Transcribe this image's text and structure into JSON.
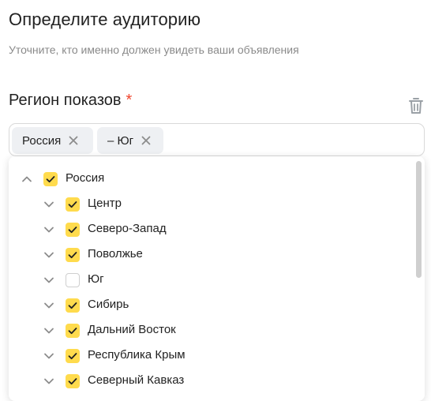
{
  "header": {
    "title": "Определите аудиторию",
    "subtitle": "Уточните, кто именно должен увидеть ваши объявления"
  },
  "region": {
    "label": "Регион показов",
    "required_mark": "*",
    "chips": [
      {
        "label": "Россия"
      },
      {
        "label": "– Юг"
      }
    ]
  },
  "tree": {
    "root": {
      "label": "Россия",
      "checked": true,
      "expanded": true
    },
    "children": [
      {
        "label": "Центр",
        "checked": true
      },
      {
        "label": "Северо-Запад",
        "checked": true
      },
      {
        "label": "Поволжье",
        "checked": true
      },
      {
        "label": "Юг",
        "checked": false
      },
      {
        "label": "Сибирь",
        "checked": true
      },
      {
        "label": "Дальний Восток",
        "checked": true
      },
      {
        "label": "Республика Крым",
        "checked": true
      },
      {
        "label": "Северный Кавказ",
        "checked": true
      }
    ]
  },
  "colors": {
    "accent": "#ffdb4d",
    "required": "#f0452e",
    "chip_bg": "#eef0f3"
  }
}
